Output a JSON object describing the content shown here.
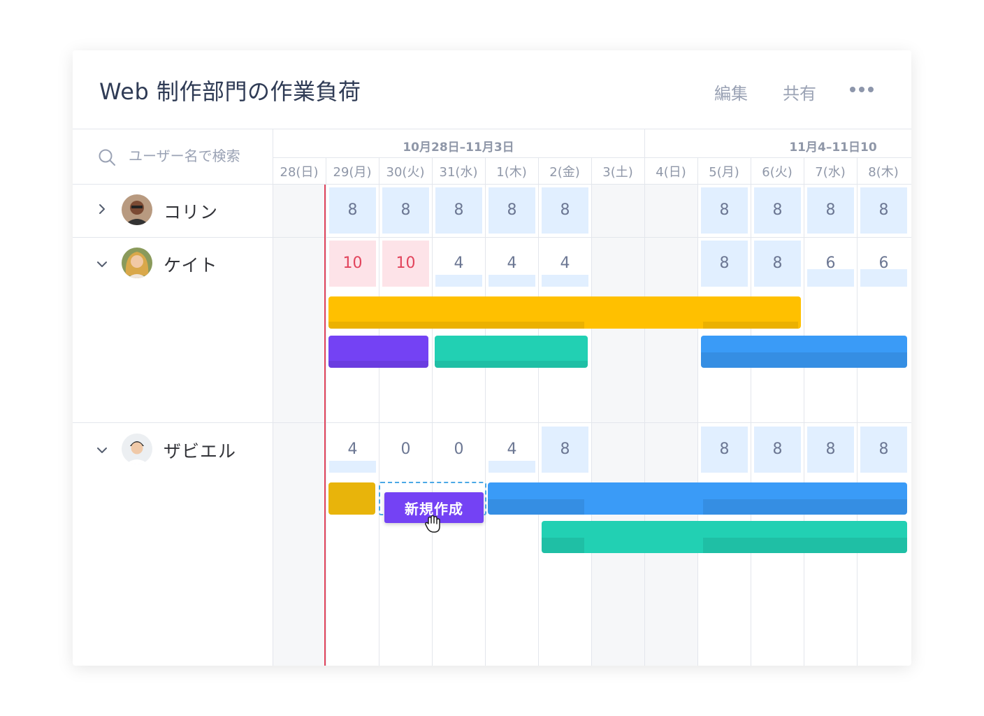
{
  "header": {
    "title": "Web 制作部門の作業負荷",
    "edit_label": "編集",
    "share_label": "共有",
    "more_icon": "more-dots-icon"
  },
  "search": {
    "placeholder": "ユーザー名で検索",
    "icon": "search-icon"
  },
  "weeks": [
    {
      "label": "10月28日–11月3日"
    },
    {
      "label": "11月4–11日10"
    }
  ],
  "days": [
    "28(日)",
    "29(月)",
    "30(火)",
    "31(水)",
    "1(木)",
    "2(金)",
    "3(土)",
    "4(日)",
    "5(月)",
    "6(火)",
    "7(水)",
    "8(木)"
  ],
  "people": [
    {
      "name": "コリン",
      "expanded": false
    },
    {
      "name": "ケイト",
      "expanded": true
    },
    {
      "name": "ザビエル",
      "expanded": true
    }
  ],
  "workload": {
    "colin": [
      "",
      "8",
      "8",
      "8",
      "8",
      "8",
      "",
      "",
      "8",
      "8",
      "8",
      "8"
    ],
    "kate": [
      "",
      "10",
      "10",
      "4",
      "4",
      "4",
      "",
      "",
      "8",
      "8",
      "6",
      "6"
    ],
    "xavier": [
      "",
      "4",
      "0",
      "0",
      "4",
      "8",
      "",
      "",
      "8",
      "8",
      "8",
      "8"
    ]
  },
  "new_task": {
    "label": "新規作成"
  },
  "colors": {
    "accent": "#7442f4",
    "overload": "#e2445c",
    "capacity": "#e1efff",
    "yellow": "#ffc000",
    "purple": "#7442f4",
    "teal": "#22d0b3",
    "blue": "#3a9bf7",
    "gold": "#e8b40b"
  }
}
